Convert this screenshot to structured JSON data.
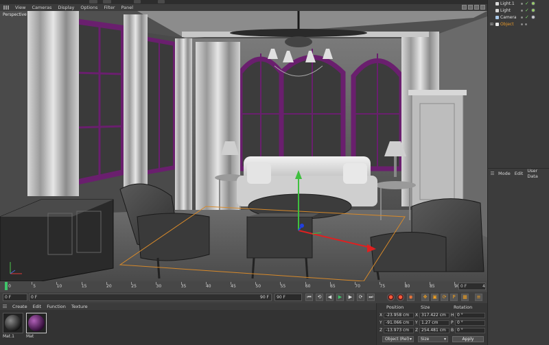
{
  "viewport": {
    "menu": [
      "View",
      "Cameras",
      "Display",
      "Options",
      "Filter",
      "Panel"
    ],
    "label": "Perspective"
  },
  "timeline": {
    "ticks": [
      "0",
      "5",
      "10",
      "15",
      "20",
      "25",
      "30",
      "35",
      "40",
      "45",
      "50",
      "55",
      "60",
      "65",
      "70",
      "75",
      "80",
      "85",
      "90"
    ],
    "end_field": "0 F",
    "end_suffix": "4"
  },
  "transport": {
    "start": "0 F",
    "range_start": "0 F",
    "range_end": "90 F",
    "end": "90 F",
    "buttons": [
      "first-frame",
      "prev-key",
      "prev-frame",
      "play",
      "next-frame",
      "next-key",
      "last-frame"
    ],
    "button_glyphs": [
      "⏮",
      "⟲",
      "◀",
      "▶",
      "▶",
      "⟳",
      "⏭"
    ]
  },
  "materials": {
    "menu": [
      "Create",
      "Edit",
      "Function",
      "Texture"
    ],
    "items": [
      {
        "name": "Mat.1",
        "color": "#1a1a1a"
      },
      {
        "name": "Mat",
        "color": "#6a1f6e"
      }
    ]
  },
  "coordinates": {
    "headers": [
      "Position",
      "Size",
      "Rotation"
    ],
    "rows": [
      {
        "axis": "X",
        "position": "-23.958 cm",
        "size_axis": "X",
        "size": "317.422 cm",
        "rot_axis": "H",
        "rotation": "0 °"
      },
      {
        "axis": "Y",
        "position": "-91.066 cm",
        "size_axis": "Y",
        "size": "1.27 cm",
        "rot_axis": "P",
        "rotation": "0 °"
      },
      {
        "axis": "Z",
        "position": "-13.973 cm",
        "size_axis": "Z",
        "size": "254.481 cm",
        "rot_axis": "B",
        "rotation": "0 °"
      }
    ],
    "mode_select": "Object (Rel)",
    "size_select": "Size",
    "apply": "Apply"
  },
  "objects": [
    {
      "name": "Light.1",
      "type": "light"
    },
    {
      "name": "Light",
      "type": "light"
    },
    {
      "name": "Camera",
      "type": "camera"
    },
    {
      "name": "Object",
      "type": "null"
    }
  ],
  "attributes": {
    "menu": [
      "Mode",
      "Edit",
      "User Data"
    ]
  },
  "colors": {
    "accent_purple": "#6a1f6e",
    "timeline_green": "#3fc46a",
    "record_red": "#ff5a3a",
    "object_orange": "#e89a2a"
  }
}
